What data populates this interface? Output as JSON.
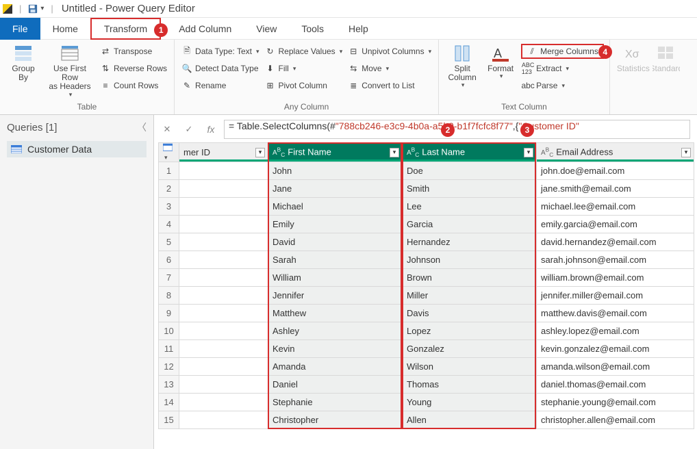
{
  "titlebar": {
    "title": "Untitled - Power Query Editor"
  },
  "menu": {
    "file": "File",
    "home": "Home",
    "transform": "Transform",
    "addcolumn": "Add Column",
    "view": "View",
    "tools": "Tools",
    "help": "Help"
  },
  "ribbon": {
    "table": {
      "label": "Table",
      "group_by": "Group\nBy",
      "use_first_row": "Use First Row\nas Headers",
      "transpose": "Transpose",
      "reverse_rows": "Reverse Rows",
      "count_rows": "Count Rows"
    },
    "anycol": {
      "label": "Any Column",
      "data_type": "Data Type: Text",
      "detect": "Detect Data Type",
      "rename": "Rename",
      "replace": "Replace Values",
      "fill": "Fill",
      "pivot": "Pivot Column",
      "unpivot": "Unpivot Columns",
      "move": "Move",
      "convert": "Convert to List"
    },
    "textcol": {
      "label": "Text Column",
      "split": "Split\nColumn",
      "format": "Format",
      "merge": "Merge Columns",
      "extract": "Extract",
      "parse": "Parse"
    },
    "numcol": {
      "statistics": "Statistics",
      "standard": "Standard"
    }
  },
  "sidebar": {
    "header": "Queries [1]",
    "query": "Customer Data"
  },
  "formula": {
    "prefix": "= Table.SelectColumns(#",
    "str1": "\"788cb246-e3c9-4b0a-a5b9-b1f7fcfc8f77\"",
    "mid": ",{",
    "str2": "\"Customer ID\"",
    "suffix": ""
  },
  "columns": {
    "id": "mer ID",
    "first": "First Name",
    "last": "Last Name",
    "email": "Email Address"
  },
  "rows": [
    {
      "n": 1,
      "first": "John",
      "last": "Doe",
      "email": "john.doe@email.com"
    },
    {
      "n": 2,
      "first": "Jane",
      "last": "Smith",
      "email": "jane.smith@email.com"
    },
    {
      "n": 3,
      "first": "Michael",
      "last": "Lee",
      "email": "michael.lee@email.com"
    },
    {
      "n": 4,
      "first": "Emily",
      "last": "Garcia",
      "email": "emily.garcia@email.com"
    },
    {
      "n": 5,
      "first": "David",
      "last": "Hernandez",
      "email": "david.hernandez@email.com"
    },
    {
      "n": 6,
      "first": "Sarah",
      "last": "Johnson",
      "email": "sarah.johnson@email.com"
    },
    {
      "n": 7,
      "first": "William",
      "last": "Brown",
      "email": "william.brown@email.com"
    },
    {
      "n": 8,
      "first": "Jennifer",
      "last": "Miller",
      "email": "jennifer.miller@email.com"
    },
    {
      "n": 9,
      "first": "Matthew",
      "last": "Davis",
      "email": "matthew.davis@email.com"
    },
    {
      "n": 10,
      "first": "Ashley",
      "last": "Lopez",
      "email": "ashley.lopez@email.com"
    },
    {
      "n": 11,
      "first": "Kevin",
      "last": "Gonzalez",
      "email": "kevin.gonzalez@email.com"
    },
    {
      "n": 12,
      "first": "Amanda",
      "last": "Wilson",
      "email": "amanda.wilson@email.com"
    },
    {
      "n": 13,
      "first": "Daniel",
      "last": "Thomas",
      "email": "daniel.thomas@email.com"
    },
    {
      "n": 14,
      "first": "Stephanie",
      "last": "Young",
      "email": "stephanie.young@email.com"
    },
    {
      "n": 15,
      "first": "Christopher",
      "last": "Allen",
      "email": "christopher.allen@email.com"
    }
  ],
  "badges": {
    "b1": "1",
    "b2": "2",
    "b3": "3",
    "b4": "4"
  }
}
